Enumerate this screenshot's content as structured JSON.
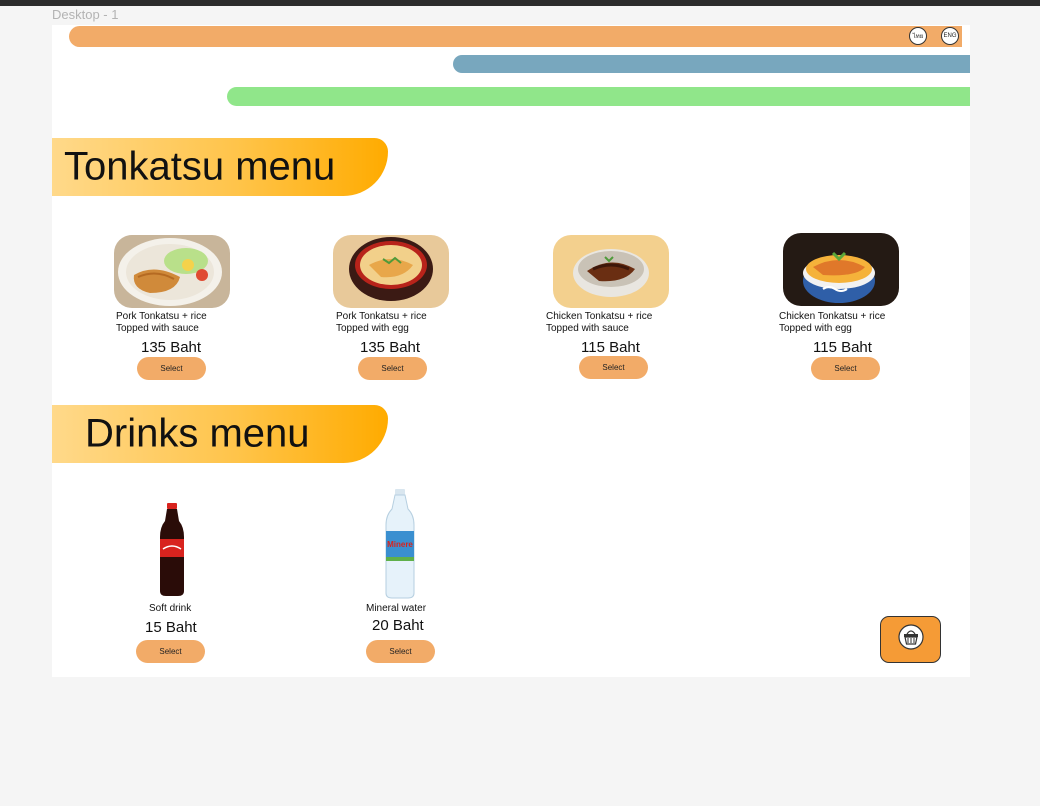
{
  "frame_label": "Desktop - 1",
  "language": {
    "thai": "ไทย",
    "english": "ENG"
  },
  "sections": {
    "food_title": "Tonkatsu menu",
    "drinks_title": "Drinks menu"
  },
  "food_items": [
    {
      "name_line1": "Pork Tonkatsu + rice",
      "name_line2": "Topped with sauce",
      "price": "135 Baht",
      "button": "Select"
    },
    {
      "name_line1": "Pork Tonkatsu + rice",
      "name_line2": "Topped with egg",
      "price": "135 Baht",
      "button": "Select"
    },
    {
      "name_line1": "Chicken Tonkatsu + rice",
      "name_line2": "Topped with sauce",
      "price": "115 Baht",
      "button": "Select"
    },
    {
      "name_line1": "Chicken Tonkatsu + rice",
      "name_line2": "Topped with egg",
      "price": "115 Baht",
      "button": "Select"
    }
  ],
  "drink_items": [
    {
      "name": "Soft drink",
      "price": "15 Baht",
      "button": "Select"
    },
    {
      "name": "Mineral water",
      "price": "20 Baht",
      "button": "Select"
    }
  ],
  "basket": {
    "icon": "basket-icon"
  },
  "colors": {
    "accent": "#f2ab68",
    "basket": "#f59b36",
    "blue_bar": "#78a7be",
    "green_bar": "#90e68a"
  }
}
